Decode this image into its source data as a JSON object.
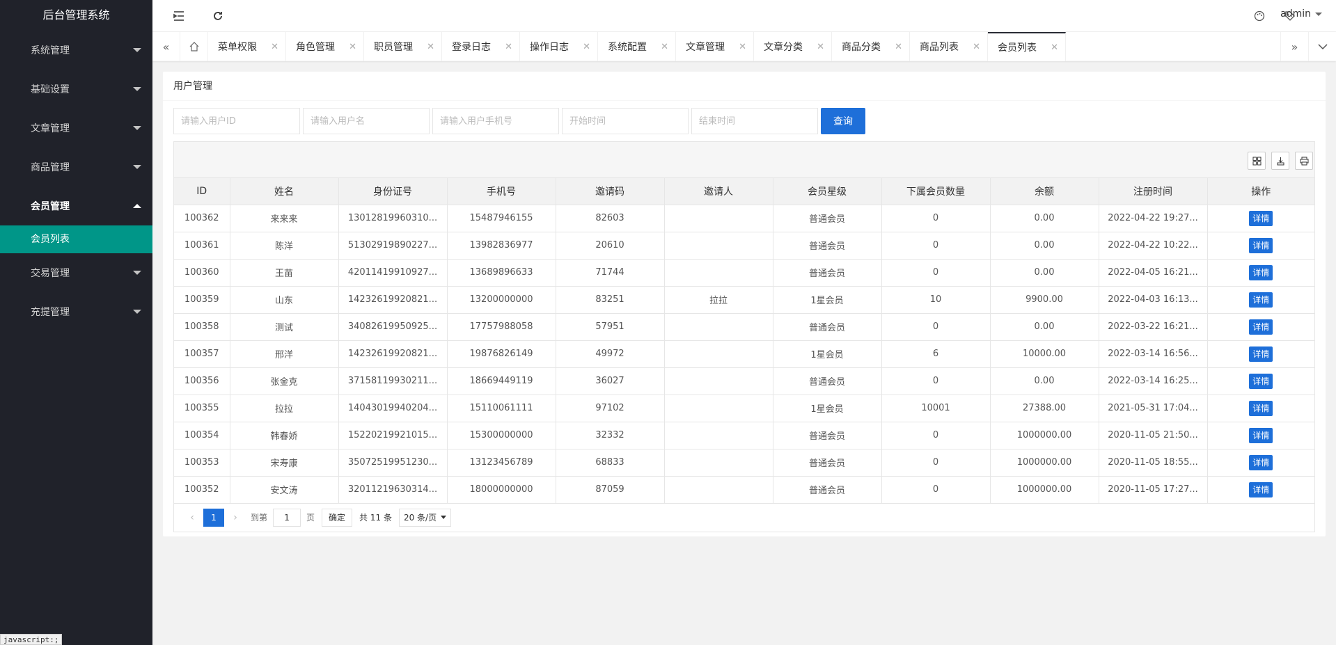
{
  "sidebar": {
    "logo": "后台管理系统",
    "items": [
      {
        "label": "系统管理"
      },
      {
        "label": "基础设置"
      },
      {
        "label": "文章管理"
      },
      {
        "label": "商品管理"
      },
      {
        "label": "会员管理"
      },
      {
        "label": "交易管理"
      },
      {
        "label": "充提管理"
      }
    ],
    "active_sub": "会员列表",
    "status_tip": "javascript:;"
  },
  "header": {
    "user": "admin"
  },
  "tabs": [
    {
      "label": "菜单权限"
    },
    {
      "label": "角色管理"
    },
    {
      "label": "职员管理"
    },
    {
      "label": "登录日志"
    },
    {
      "label": "操作日志"
    },
    {
      "label": "系统配置"
    },
    {
      "label": "文章管理"
    },
    {
      "label": "文章分类"
    },
    {
      "label": "商品分类"
    },
    {
      "label": "商品列表"
    },
    {
      "label": "会员列表"
    }
  ],
  "card": {
    "title": "用户管理",
    "search": {
      "uid_placeholder": "请输入用户ID",
      "name_placeholder": "请输入用户名",
      "phone_placeholder": "请输入用户手机号",
      "start_placeholder": "开始时间",
      "end_placeholder": "结束时间",
      "query_label": "查询"
    }
  },
  "table": {
    "headers": [
      "ID",
      "姓名",
      "身份证号",
      "手机号",
      "邀请码",
      "邀请人",
      "会员星级",
      "下属会员数量",
      "余额",
      "注册时间",
      "操作"
    ],
    "action_label": "详情",
    "rows": [
      [
        "100362",
        "来来来",
        "13012819960310...",
        "15487946155",
        "82603",
        "",
        "普通会员",
        "0",
        "0.00",
        "2022-04-22 19:27..."
      ],
      [
        "100361",
        "陈洋",
        "51302919890227...",
        "13982836977",
        "20610",
        "",
        "普通会员",
        "0",
        "0.00",
        "2022-04-22 10:22..."
      ],
      [
        "100360",
        "王苗",
        "42011419910927...",
        "13689896633",
        "71744",
        "",
        "普通会员",
        "0",
        "0.00",
        "2022-04-05 16:21..."
      ],
      [
        "100359",
        "山东",
        "14232619920821...",
        "13200000000",
        "83251",
        "拉拉",
        "1星会员",
        "10",
        "9900.00",
        "2022-04-03 16:13..."
      ],
      [
        "100358",
        "测试",
        "34082619950925...",
        "17757988058",
        "57951",
        "",
        "普通会员",
        "0",
        "0.00",
        "2022-03-22 16:21..."
      ],
      [
        "100357",
        "邢洋",
        "14232619920821...",
        "19876826149",
        "49972",
        "",
        "1星会员",
        "6",
        "10000.00",
        "2022-03-14 16:56..."
      ],
      [
        "100356",
        "张金克",
        "37158119930211...",
        "18669449119",
        "36027",
        "",
        "普通会员",
        "0",
        "0.00",
        "2022-03-14 16:25..."
      ],
      [
        "100355",
        "拉拉",
        "14043019940204...",
        "15110061111",
        "97102",
        "",
        "1星会员",
        "10001",
        "27388.00",
        "2021-05-31 17:04..."
      ],
      [
        "100354",
        "韩春娇",
        "15220219921015...",
        "15300000000",
        "32332",
        "",
        "普通会员",
        "0",
        "1000000.00",
        "2020-11-05 21:50..."
      ],
      [
        "100353",
        "宋寿康",
        "35072519951230...",
        "13123456789",
        "68833",
        "",
        "普通会员",
        "0",
        "1000000.00",
        "2020-11-05 18:55..."
      ],
      [
        "100352",
        "安文涛",
        "32011219630314...",
        "18000000000",
        "87059",
        "",
        "普通会员",
        "0",
        "1000000.00",
        "2020-11-05 17:27..."
      ]
    ]
  },
  "pager": {
    "current": "1",
    "goto_label": "到第",
    "page_value": "1",
    "page_unit": "页",
    "confirm_label": "确定",
    "total_label": "共 11 条",
    "size_label": "20 条/页"
  }
}
